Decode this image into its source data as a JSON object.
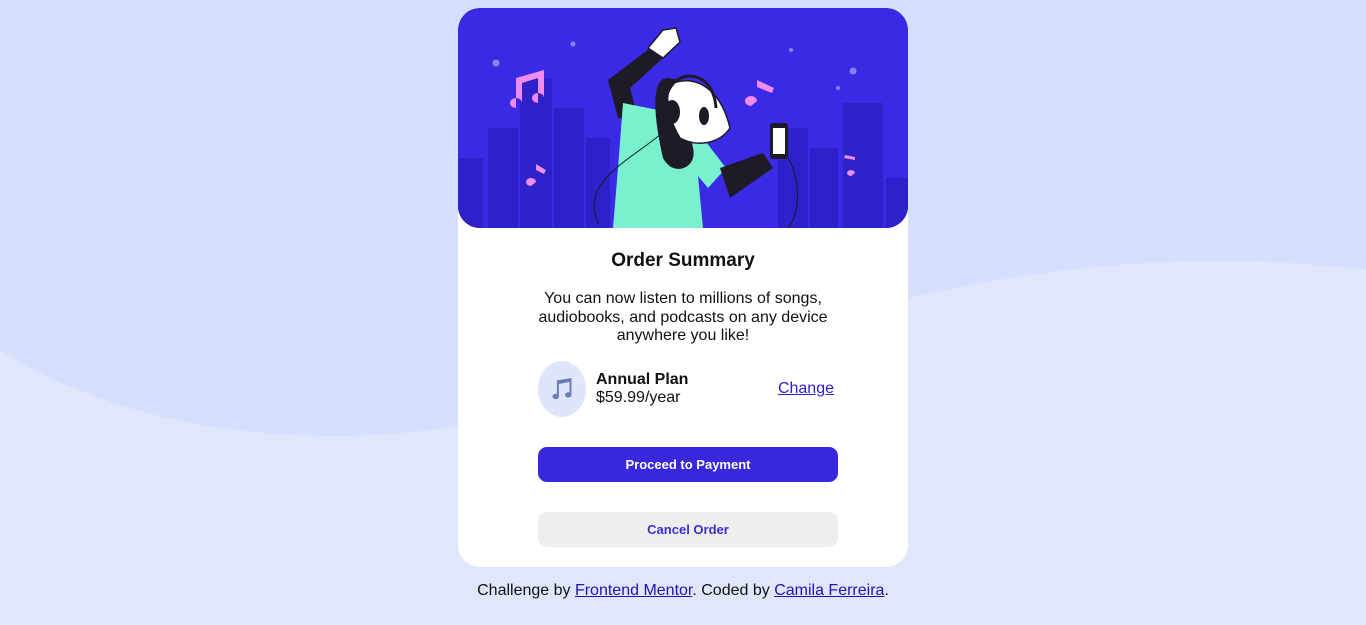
{
  "colors": {
    "page_background": "#e0e7fc",
    "wave": "#d6e0fe",
    "hero_background": "#3a2ae5",
    "accent": "#3827dd",
    "link": "#2a1ed1"
  },
  "hero": {
    "illustration": "woman-dancing-with-headphones-illustration"
  },
  "card": {
    "title": "Order Summary",
    "description": "You can now listen to millions of songs, audiobooks, and podcasts on any device anywhere you like!",
    "plan": {
      "icon": "music-note-icon",
      "name": "Annual Plan",
      "price": "$59.99/year",
      "change_label": "Change"
    },
    "proceed_label": "Proceed to Payment",
    "cancel_label": "Cancel Order"
  },
  "footer": {
    "prefix": "Challenge by ",
    "link1": "Frontend Mentor",
    "middle": ". Coded by ",
    "link2": "Camila Ferreira",
    "suffix": "."
  }
}
